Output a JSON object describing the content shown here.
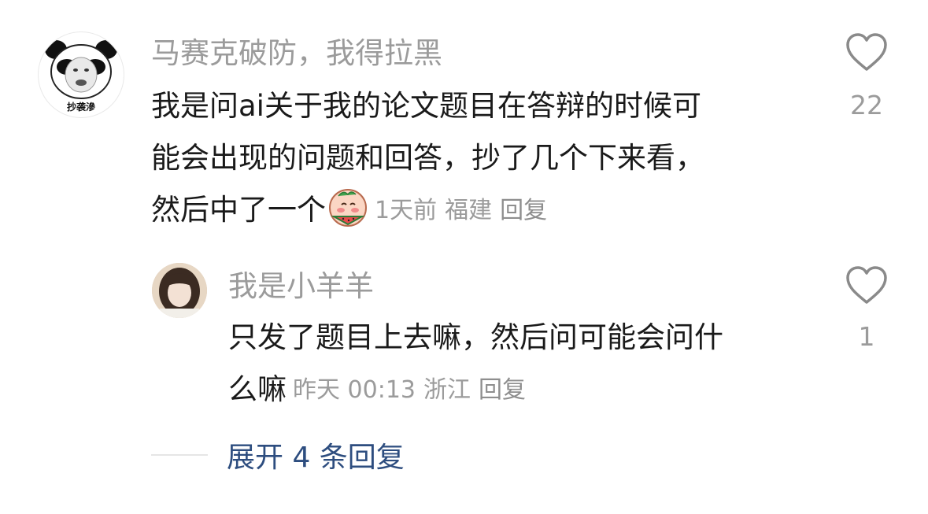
{
  "comments": [
    {
      "username": "马赛克破防，我得拉黑",
      "avatar_caption": "抄袭滲",
      "lines": [
        "我是问ai关于我的论文题目在答辩的时候可",
        "能会出现的问题和回答，抄了几个下来看，",
        "然后中了一个"
      ],
      "emoji": "watermelon-eating-blush",
      "time": "1天前",
      "location": "福建",
      "reply_label": "回复",
      "like_count": "22"
    },
    {
      "username": "我是小羊羊",
      "lines": [
        "只发了题目上去嘛，然后问可能会问什",
        "么嘛"
      ],
      "time": "昨天 00:13",
      "location": "浙江",
      "reply_label": "回复",
      "like_count": "1"
    }
  ],
  "expand_replies": "展开 4 条回复",
  "colors": {
    "username": "#9b9b9b",
    "body": "#1a1a1a",
    "meta": "#9b9b9b",
    "expand_link": "#2d4d7f",
    "divider": "#e6e6e6"
  }
}
